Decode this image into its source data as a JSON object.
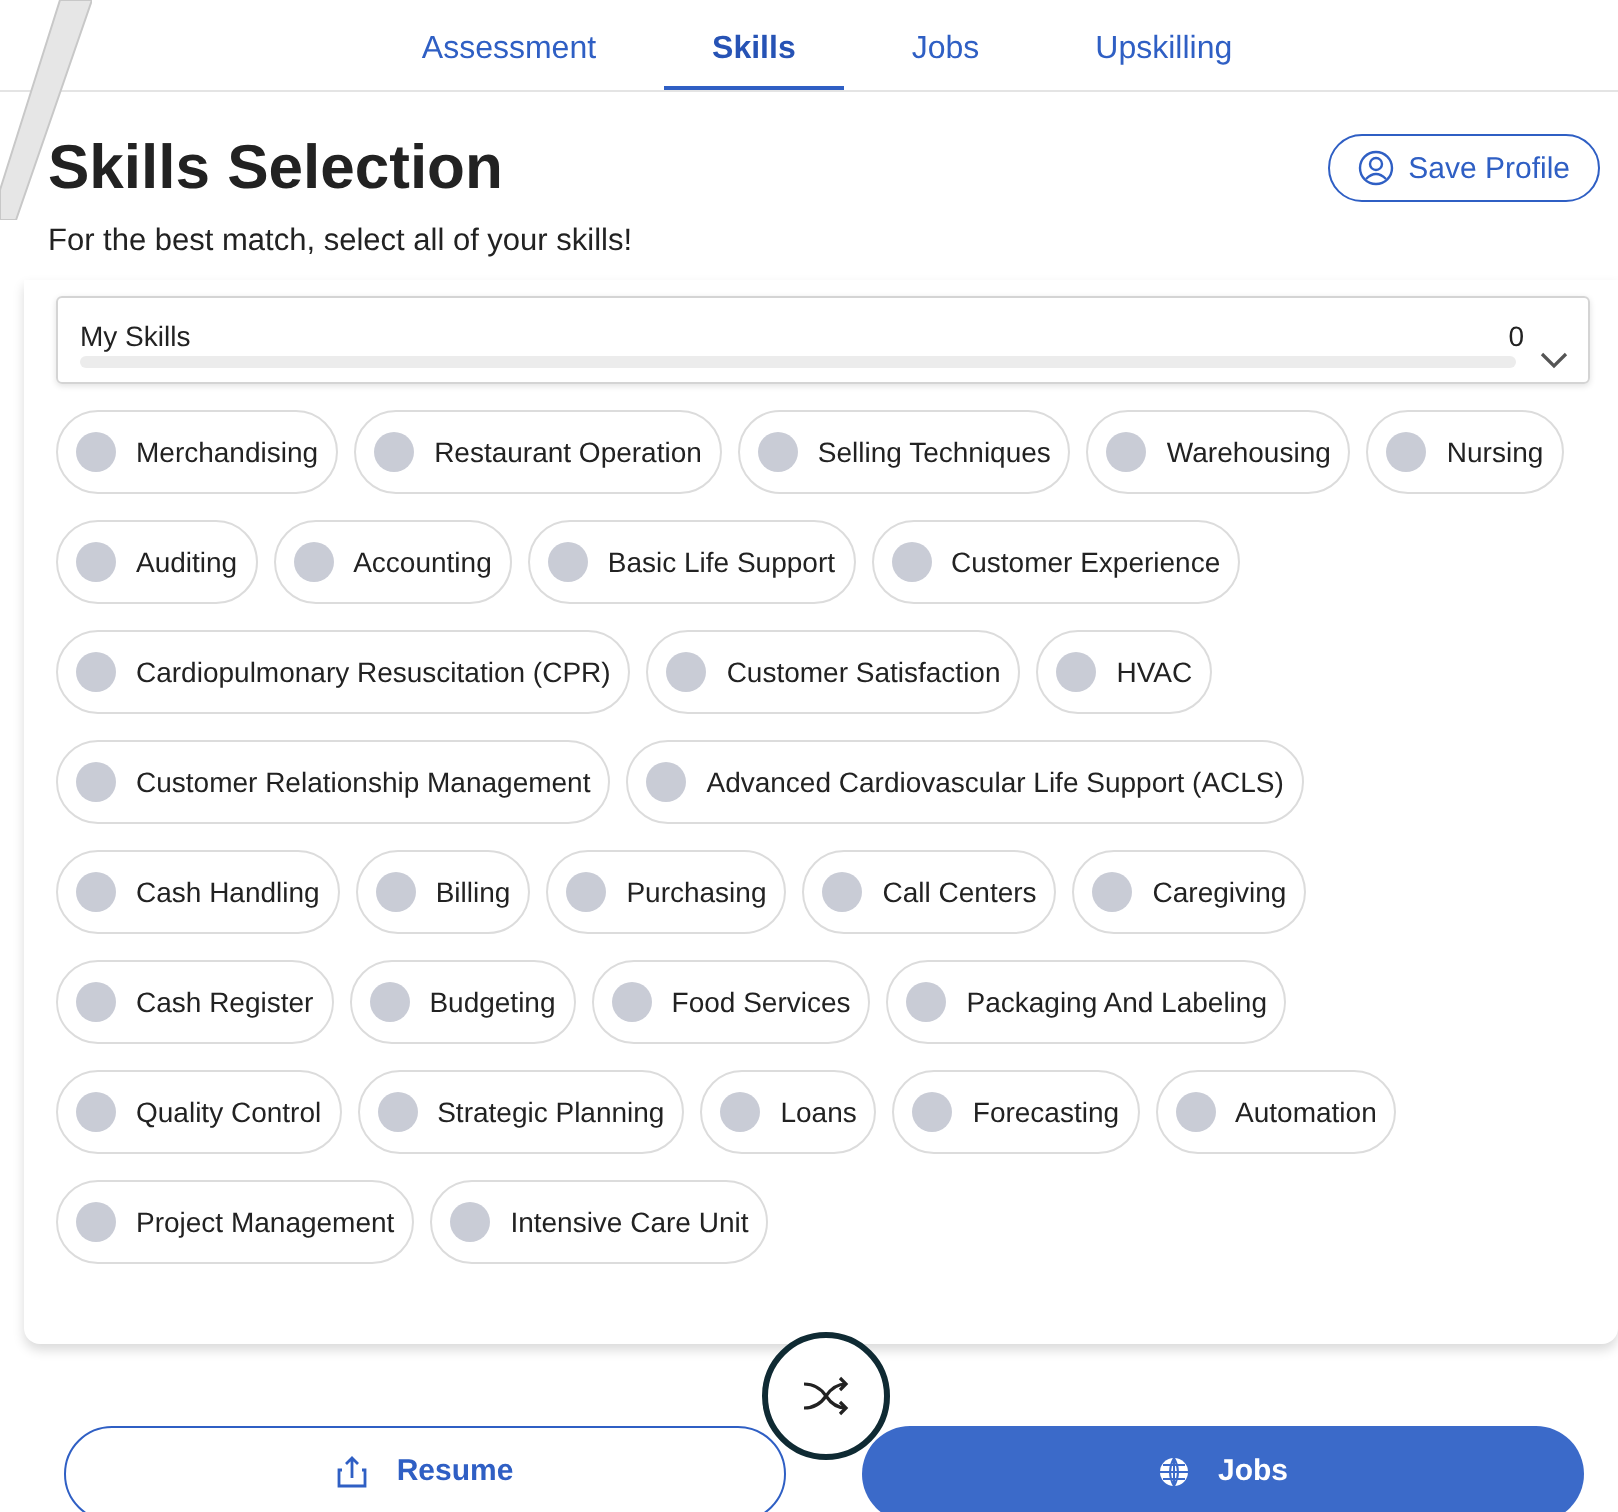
{
  "tabs": [
    {
      "label": "Assessment",
      "selected": false
    },
    {
      "label": "Skills",
      "selected": true
    },
    {
      "label": "Jobs",
      "selected": false
    },
    {
      "label": "Upskilling",
      "selected": false
    }
  ],
  "title": "Skills Selection",
  "save_button": "Save Profile",
  "subtitle": "For the best match, select all of your skills!",
  "my_skills": {
    "label": "My Skills",
    "count": "0",
    "level": 0
  },
  "skill_rows": [
    [
      {
        "label": "Merchandising",
        "selected": false
      },
      {
        "label": "Restaurant Operation",
        "selected": false
      },
      {
        "label": "Selling Techniques",
        "selected": false
      },
      {
        "label": "Warehousing",
        "selected": false
      },
      {
        "label": "Nursing",
        "selected": false
      }
    ],
    [
      {
        "label": "Auditing",
        "selected": false
      },
      {
        "label": "Accounting",
        "selected": false
      },
      {
        "label": "Basic Life Support",
        "selected": false
      },
      {
        "label": "Customer Experience",
        "selected": false
      }
    ],
    [
      {
        "label": "Cardiopulmonary Resuscitation (CPR)",
        "selected": false
      },
      {
        "label": "Customer Satisfaction",
        "selected": false
      },
      {
        "label": "HVAC",
        "selected": false
      }
    ],
    [
      {
        "label": "Customer Relationship Management",
        "selected": false
      },
      {
        "label": "Advanced Cardiovascular Life Support (ACLS)",
        "selected": false
      }
    ],
    [
      {
        "label": "Cash Handling",
        "selected": false
      },
      {
        "label": "Billing",
        "selected": false
      },
      {
        "label": "Purchasing",
        "selected": false
      },
      {
        "label": "Call Centers",
        "selected": false
      },
      {
        "label": "Caregiving",
        "selected": false
      }
    ],
    [
      {
        "label": "Cash Register",
        "selected": false
      },
      {
        "label": "Budgeting",
        "selected": false
      },
      {
        "label": "Food Services",
        "selected": false
      },
      {
        "label": "Packaging And Labeling",
        "selected": false
      }
    ],
    [
      {
        "label": "Quality Control",
        "selected": false
      },
      {
        "label": "Strategic Planning",
        "selected": false
      },
      {
        "label": "Loans",
        "selected": false
      },
      {
        "label": "Forecasting",
        "selected": false
      },
      {
        "label": "Automation",
        "selected": false
      }
    ],
    [
      {
        "label": "Project Management",
        "selected": false
      },
      {
        "label": "Intensive Care Unit",
        "selected": false
      }
    ]
  ],
  "bottom_buttons": [
    {
      "label": "Resume",
      "kind": "outline"
    },
    {
      "label": "Jobs",
      "kind": "filled"
    }
  ]
}
